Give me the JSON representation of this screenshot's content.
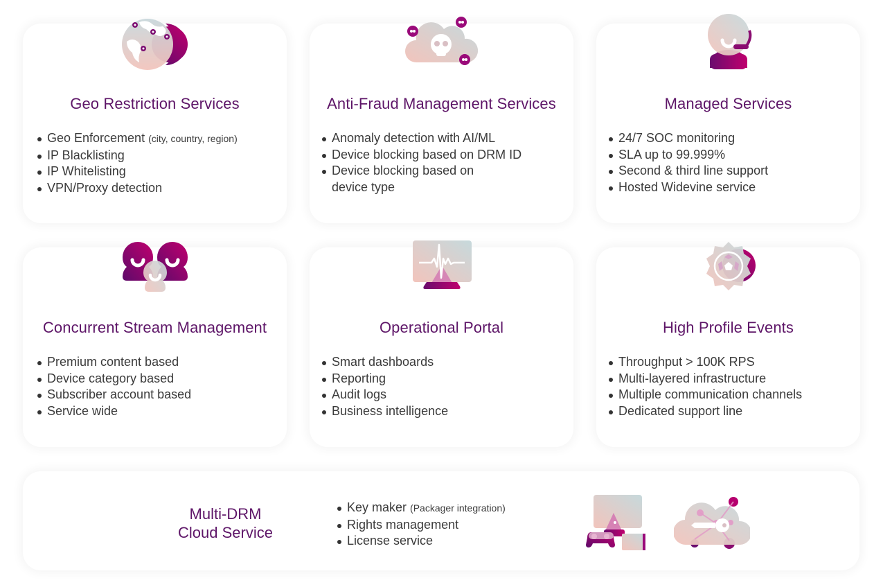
{
  "services": [
    {
      "title": "Geo Restriction Services",
      "icon": "globe-pins-icon",
      "items": [
        {
          "text": "Geo Enforcement",
          "note": "(city, country, region)"
        },
        {
          "text": "IP Blacklisting"
        },
        {
          "text": "IP Whitelisting"
        },
        {
          "text": "VPN/Proxy detection"
        }
      ]
    },
    {
      "title": "Anti-Fraud Management Services",
      "icon": "cloud-skull-icon",
      "items": [
        {
          "text": "Anomaly detection with AI/ML"
        },
        {
          "text": "Device blocking based on DRM ID"
        },
        {
          "text": "Device blocking based on",
          "text2": "device type"
        }
      ]
    },
    {
      "title": "Managed Services",
      "icon": "support-headset-icon",
      "items": [
        {
          "text": "24/7 SOC monitoring"
        },
        {
          "text": "SLA up to 99.999%"
        },
        {
          "text": "Second & third line support"
        },
        {
          "text": "Hosted Widevine service"
        }
      ]
    },
    {
      "title": "Concurrent Stream Management",
      "icon": "users-group-icon",
      "items": [
        {
          "text": "Premium content based"
        },
        {
          "text": "Device category based"
        },
        {
          "text": "Subscriber account based"
        },
        {
          "text": "Service wide"
        }
      ]
    },
    {
      "title": "Operational Portal",
      "icon": "monitor-pulse-icon",
      "items": [
        {
          "text": "Smart dashboards"
        },
        {
          "text": "Reporting"
        },
        {
          "text": "Audit logs"
        },
        {
          "text": "Business intelligence"
        }
      ]
    },
    {
      "title": "High Profile Events",
      "icon": "soccer-badge-icon",
      "items": [
        {
          "text": "Throughput > 100K RPS"
        },
        {
          "text": "Multi-layered infrastructure"
        },
        {
          "text": "Multiple communication channels"
        },
        {
          "text": "Dedicated support line"
        }
      ]
    }
  ],
  "multidrm": {
    "title_line1": "Multi-DRM",
    "title_line2": "Cloud Service",
    "items": [
      {
        "text": "Key maker",
        "note": "(Packager integration)"
      },
      {
        "text": "Rights management"
      },
      {
        "text": "License service"
      }
    ],
    "icons": [
      "devices-icon",
      "cloud-key-icon"
    ]
  },
  "colors": {
    "title": "#5e1668",
    "text": "#3b3b3b",
    "accent_dark": "#6a0c6e",
    "accent_magenta": "#b5006e",
    "pastel_pink": "#efc7c0",
    "pastel_blue": "#c9d8dc"
  }
}
